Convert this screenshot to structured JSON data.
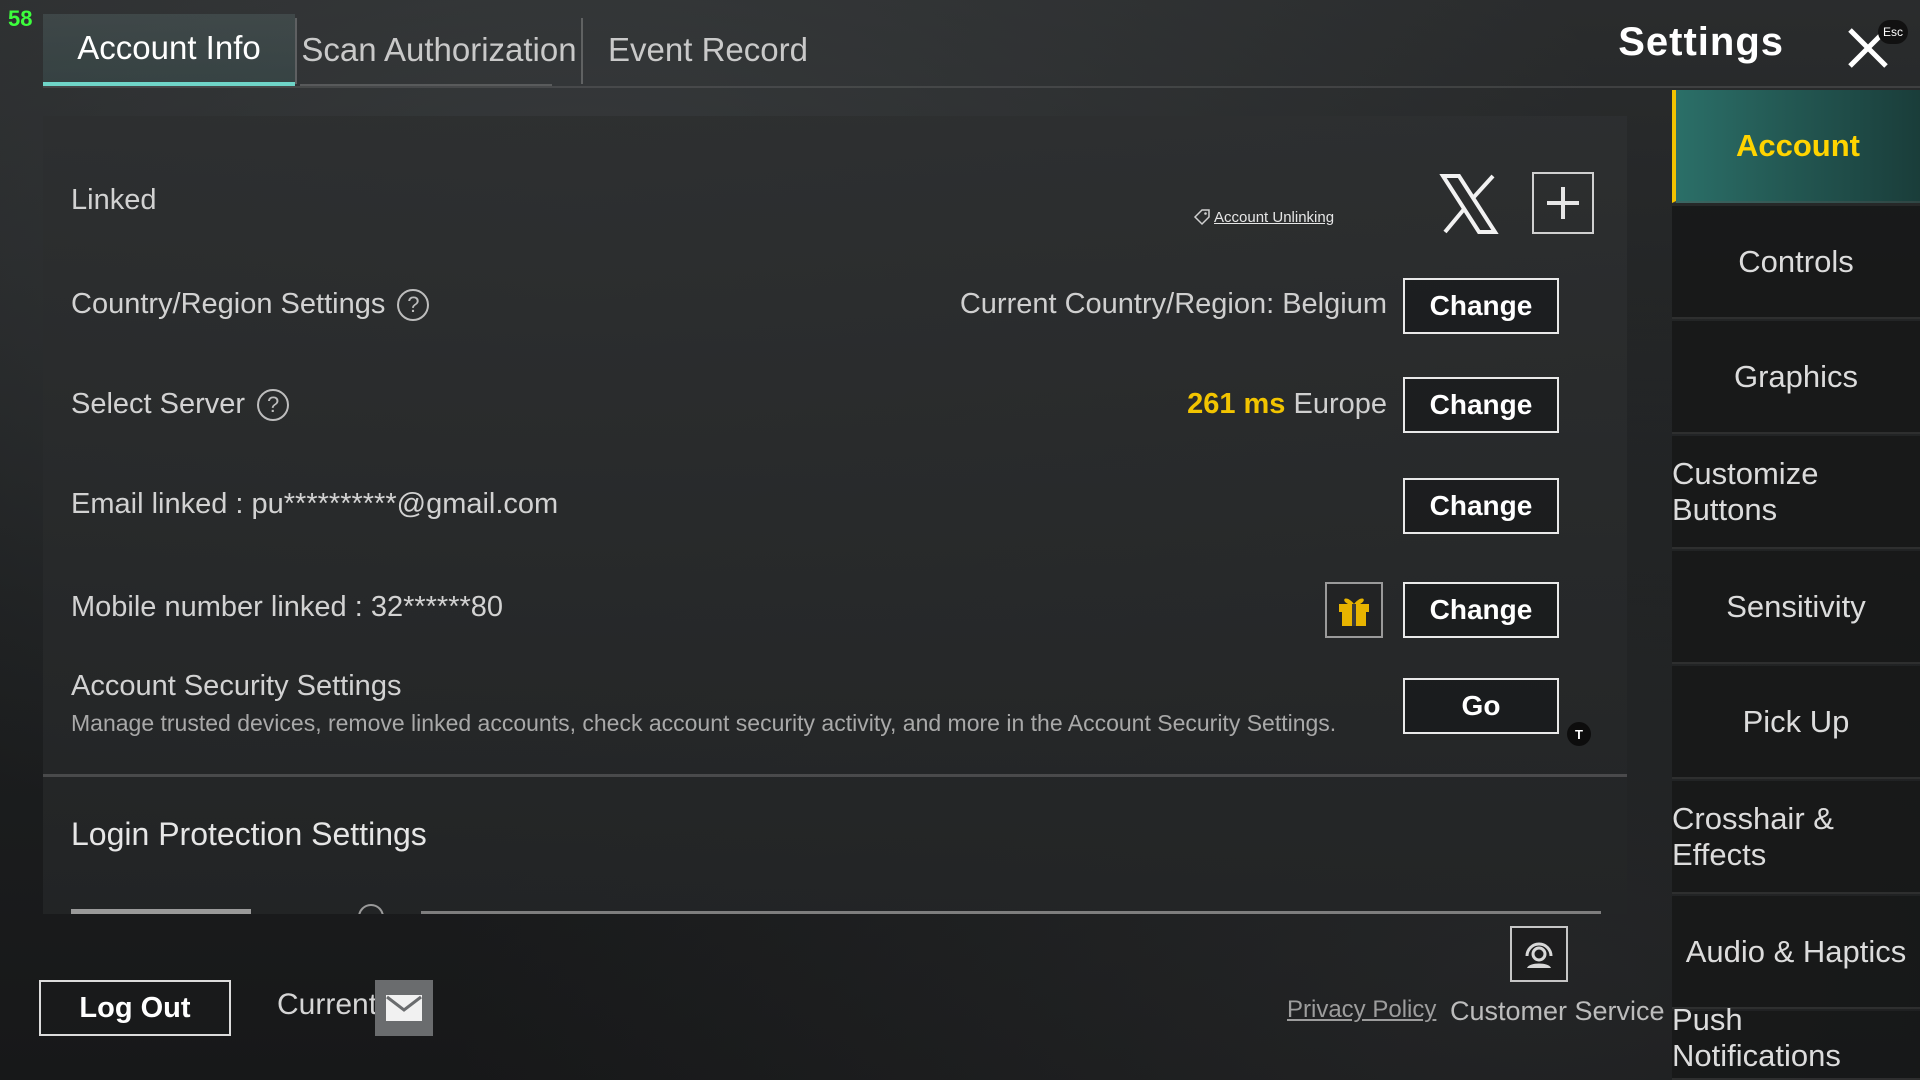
{
  "overlay": {
    "fps": "58"
  },
  "tabs": [
    {
      "label": "Account Info",
      "active": true
    },
    {
      "label": "Scan Authorization",
      "active": false
    },
    {
      "label": "Event Record",
      "active": false
    }
  ],
  "header": {
    "title": "Settings",
    "close_hint": "Esc"
  },
  "account": {
    "linked_label": "Linked",
    "unlink_label": "Account Unlinking",
    "country_label": "Country/Region Settings",
    "country_value": "Current Country/Region: Belgium",
    "country_button": "Change",
    "server_label": "Select Server",
    "server_ping": "261 ms",
    "server_region": "Europe",
    "server_button": "Change",
    "email_label": "Email linked : pu**********@gmail.com",
    "email_button": "Change",
    "mobile_label": "Mobile number linked : 32******80",
    "mobile_button": "Change",
    "security_title": "Account Security Settings",
    "security_desc": "Manage trusted devices, remove linked accounts, check account security activity, and more in the Account Security Settings.",
    "security_button": "Go",
    "security_badge": "T",
    "login_protection_title": "Login Protection Settings"
  },
  "footer": {
    "logout": "Log Out",
    "current": "Current",
    "privacy": "Privacy Policy",
    "customer_service": "Customer Service"
  },
  "sidebar": {
    "items": [
      {
        "label": "Account",
        "active": true
      },
      {
        "label": "Controls"
      },
      {
        "label": "Graphics"
      },
      {
        "label": "Customize Buttons"
      },
      {
        "label": "Sensitivity"
      },
      {
        "label": "Pick Up"
      },
      {
        "label": "Crosshair & Effects"
      },
      {
        "label": "Audio & Haptics"
      },
      {
        "label": "Push Notifications"
      }
    ]
  },
  "colors": {
    "accent": "#6fd5c8",
    "highlight": "#ffd400",
    "ping": "#f2c400"
  }
}
